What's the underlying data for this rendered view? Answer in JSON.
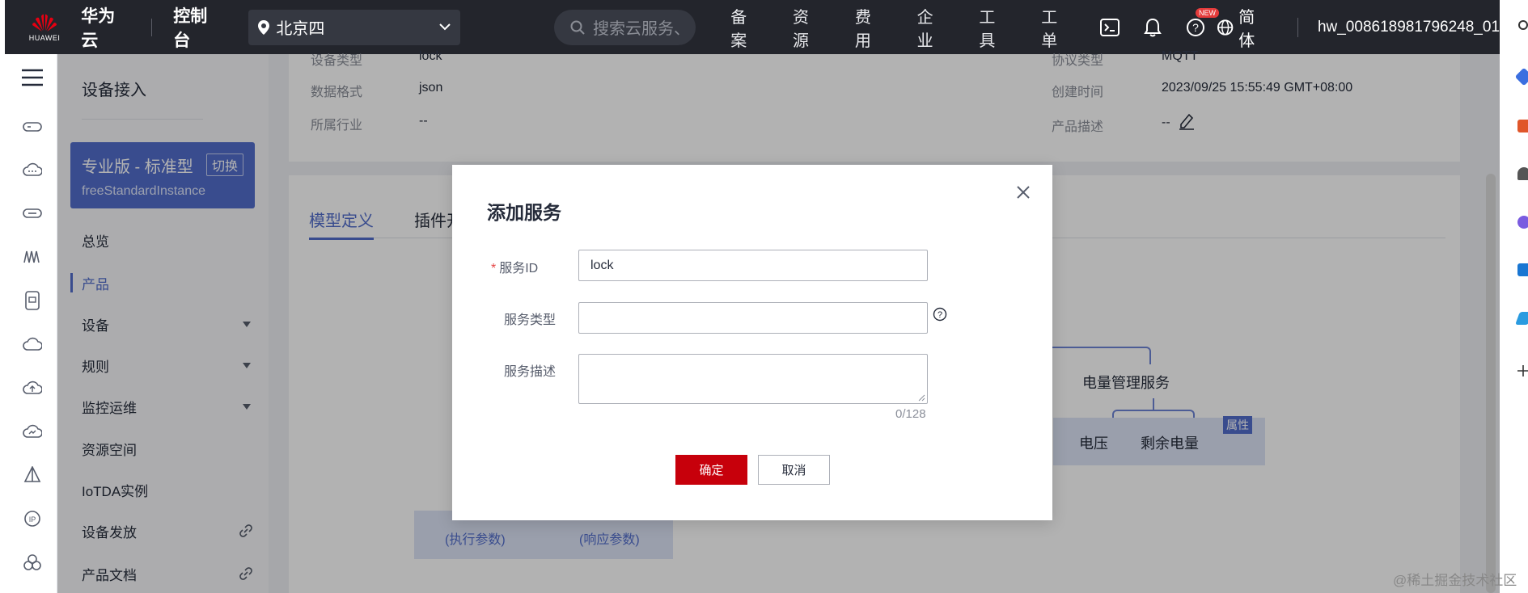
{
  "topbar": {
    "logo_text": "HUAWEI",
    "brand": "华为云",
    "console": "控制台",
    "region": "北京四",
    "search_placeholder": "搜索云服务、",
    "nav": [
      "备案",
      "资源",
      "费用",
      "企业",
      "工具",
      "工单"
    ],
    "new_badge": "NEW",
    "lang": "简体",
    "user": "hw_008618981796248_01"
  },
  "sidebar": {
    "title": "设备接入",
    "edition_name": "专业版 - 标准型",
    "edition_switch": "切换",
    "edition_instance": "freeStandardInstance",
    "items": [
      {
        "label": "总览"
      },
      {
        "label": "产品"
      },
      {
        "label": "设备"
      },
      {
        "label": "规则"
      },
      {
        "label": "监控运维"
      },
      {
        "label": "资源空间"
      },
      {
        "label": "IoTDA实例"
      },
      {
        "label": "设备发放"
      },
      {
        "label": "产品文档"
      }
    ]
  },
  "product_info": {
    "device_type_label": "设备类型",
    "device_type_value": "lock",
    "protocol_label": "协议类型",
    "protocol_value": "MQTT",
    "data_format_label": "数据格式",
    "data_format_value": "json",
    "created_label": "创建时间",
    "created_value": "2023/09/25 15:55:49 GMT+08:00",
    "industry_label": "所属行业",
    "industry_value": "--",
    "desc_label": "产品描述",
    "desc_value": "--"
  },
  "tabs": {
    "model": "模型定义",
    "plugin": "插件开"
  },
  "diagram": {
    "service": "电量管理服务",
    "attr1": "电压",
    "attr2": "剩余电量",
    "attr_tag": "属性",
    "cmd_left": "(执行参数)",
    "cmd_right": "(响应参数)"
  },
  "dialog": {
    "title": "添加服务",
    "service_id_label": "服务ID",
    "service_id_value": "lock",
    "service_type_label": "服务类型",
    "service_type_value": "",
    "service_desc_label": "服务描述",
    "counter": "0/128",
    "ok": "确定",
    "cancel": "取消"
  },
  "watermark": "@稀土掘金技术社区"
}
